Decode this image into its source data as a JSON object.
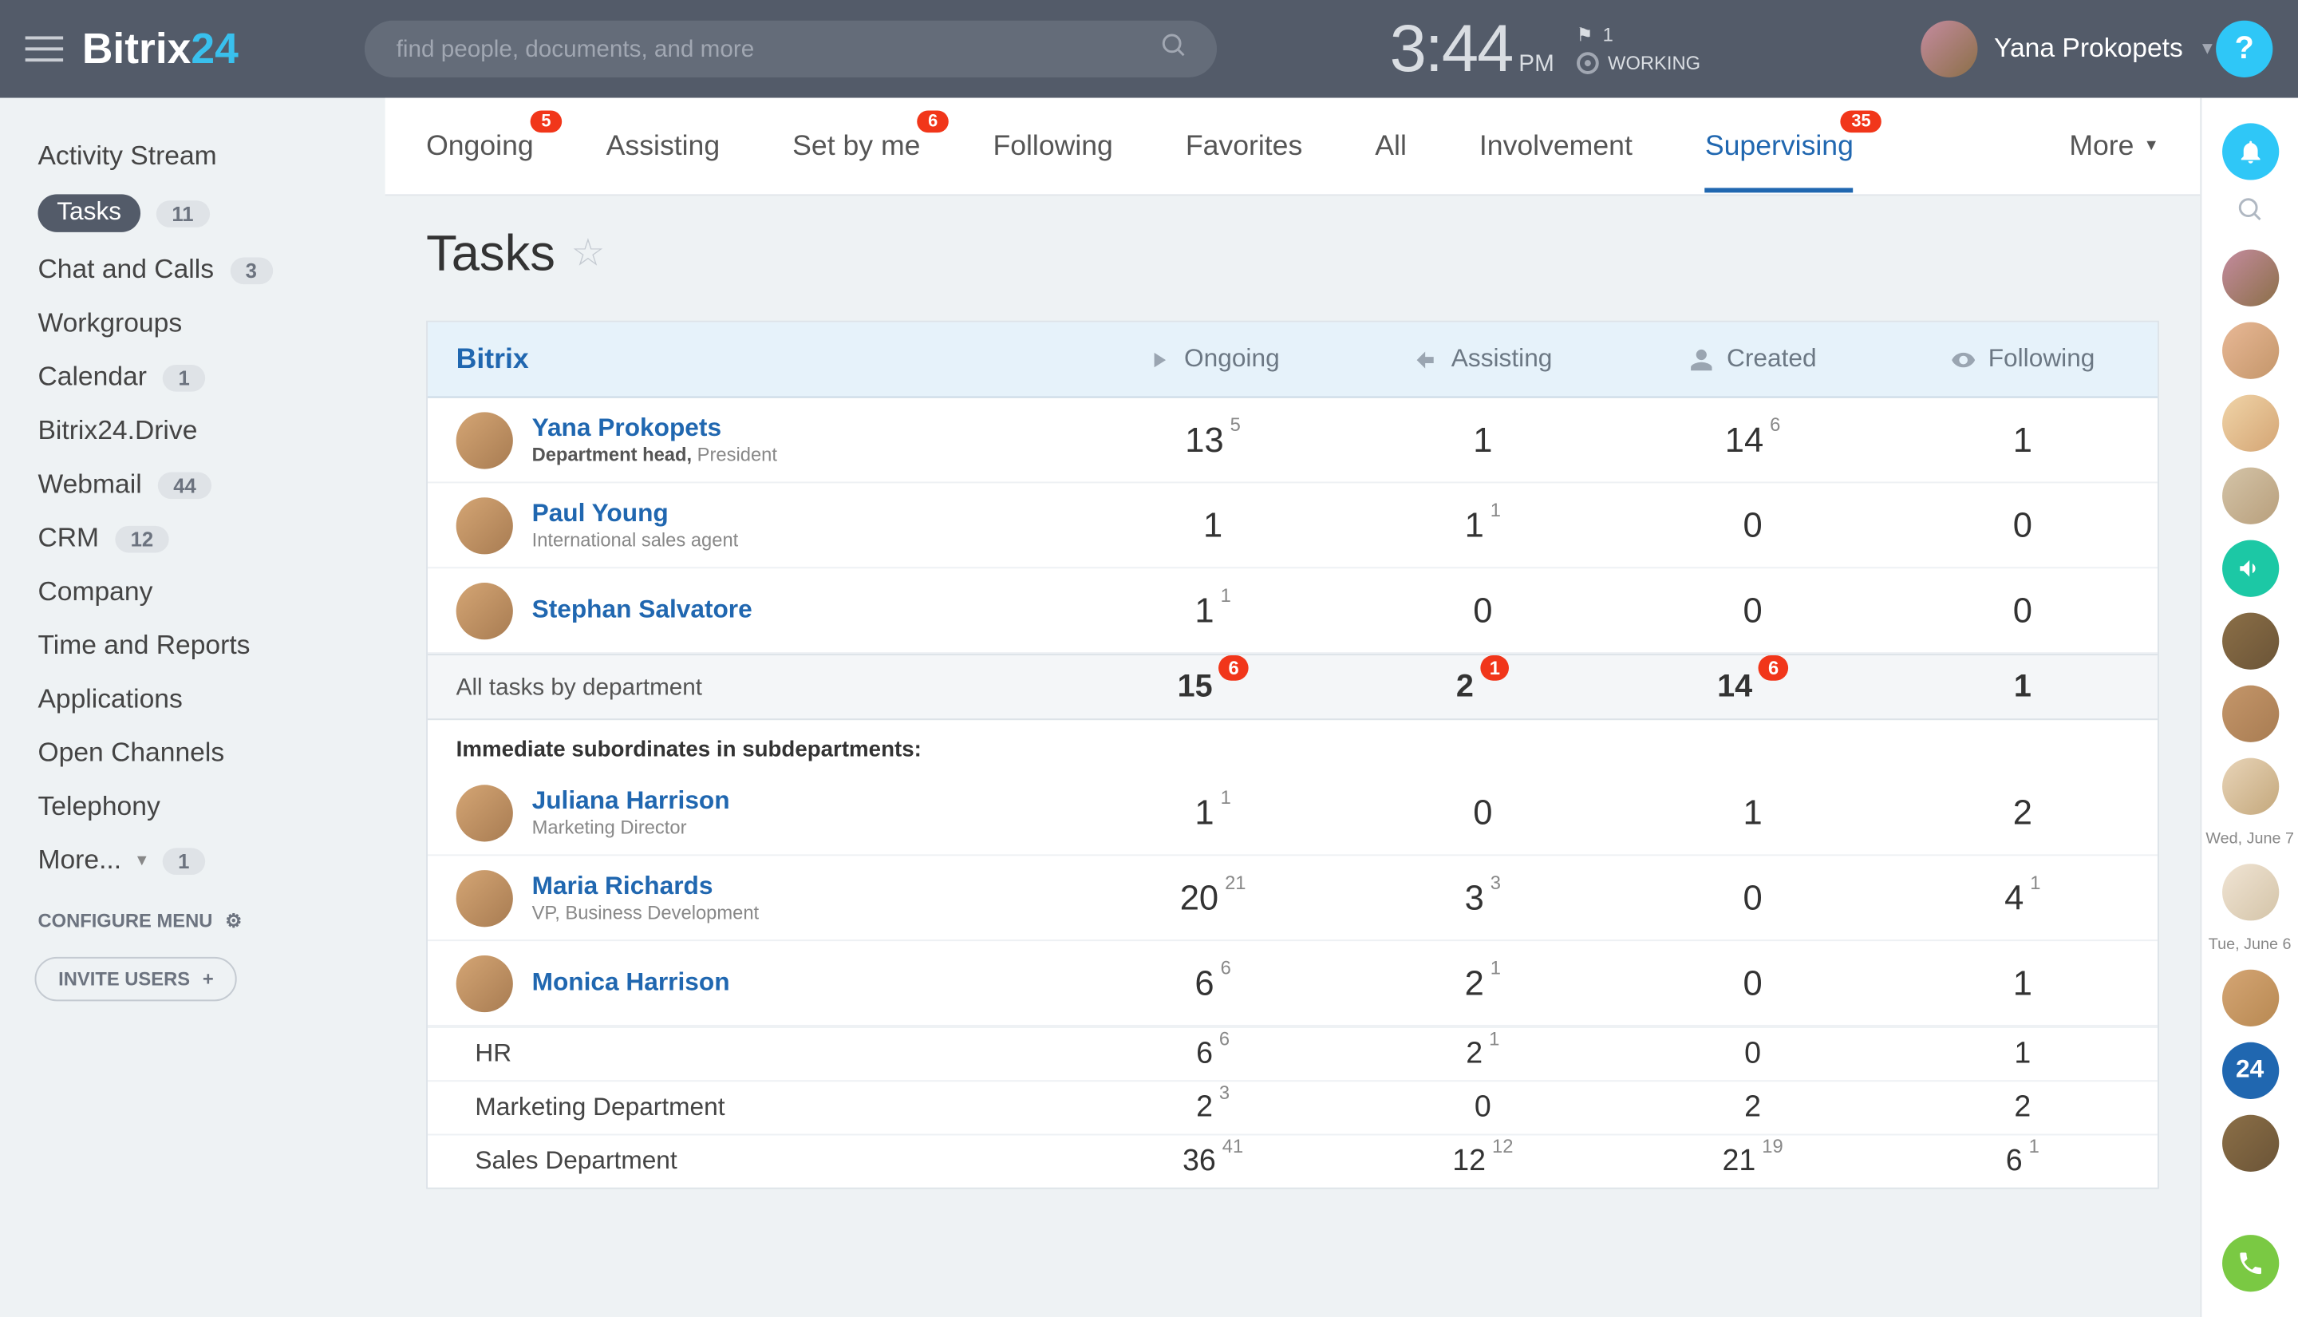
{
  "header": {
    "logo_main": "Bitrix",
    "logo_accent": "24",
    "search_placeholder": "find people, documents, and more",
    "clock_time": "3:44",
    "clock_ampm": "PM",
    "flag_count": "1",
    "working_label": "WORKING",
    "user_name": "Yana Prokopets",
    "help_label": "?"
  },
  "sidebar": {
    "items": [
      {
        "label": "Activity Stream",
        "count": ""
      },
      {
        "label": "Tasks",
        "count": "11",
        "active": true
      },
      {
        "label": "Chat and Calls",
        "count": "3"
      },
      {
        "label": "Workgroups",
        "count": ""
      },
      {
        "label": "Calendar",
        "count": "1"
      },
      {
        "label": "Bitrix24.Drive",
        "count": ""
      },
      {
        "label": "Webmail",
        "count": "44"
      },
      {
        "label": "CRM",
        "count": "12"
      },
      {
        "label": "Company",
        "count": ""
      },
      {
        "label": "Time and Reports",
        "count": ""
      },
      {
        "label": "Applications",
        "count": ""
      },
      {
        "label": "Open Channels",
        "count": ""
      },
      {
        "label": "Telephony",
        "count": ""
      }
    ],
    "more_label": "More...",
    "more_count": "1",
    "configure_label": "CONFIGURE MENU",
    "invite_label": "INVITE USERS"
  },
  "tabs": [
    {
      "label": "Ongoing",
      "badge": "5"
    },
    {
      "label": "Assisting",
      "badge": ""
    },
    {
      "label": "Set by me",
      "badge": "6"
    },
    {
      "label": "Following",
      "badge": ""
    },
    {
      "label": "Favorites",
      "badge": ""
    },
    {
      "label": "All",
      "badge": ""
    },
    {
      "label": "Involvement",
      "badge": ""
    },
    {
      "label": "Supervising",
      "badge": "35",
      "active": true
    }
  ],
  "tab_more": "More",
  "page_title": "Tasks",
  "table": {
    "org": "Bitrix",
    "cols": [
      "Ongoing",
      "Assisting",
      "Created",
      "Following"
    ],
    "rows": [
      {
        "name": "Yana Prokopets",
        "role_b": "Department head,",
        "role": " President",
        "cells": [
          "13",
          "1",
          "14",
          "1"
        ],
        "sups": [
          "5",
          "",
          "6",
          ""
        ]
      },
      {
        "name": "Paul Young",
        "role_b": "",
        "role": "International sales agent",
        "cells": [
          "1",
          "1",
          "0",
          "0"
        ],
        "sups": [
          "",
          "1",
          "",
          ""
        ]
      },
      {
        "name": "Stephan Salvatore",
        "role_b": "",
        "role": "",
        "cells": [
          "1",
          "0",
          "0",
          "0"
        ],
        "sups": [
          "1",
          "",
          "",
          ""
        ]
      }
    ],
    "subtotal_label": "All tasks by department",
    "subtotal_cells": [
      "15",
      "2",
      "14",
      "1"
    ],
    "subtotal_sups": [
      "6",
      "1",
      "6",
      ""
    ],
    "subhead": "Immediate subordinates in subdepartments:",
    "subs": [
      {
        "name": "Juliana Harrison",
        "role": "Marketing Director",
        "cells": [
          "1",
          "0",
          "1",
          "2"
        ],
        "sups": [
          "1",
          "",
          "",
          ""
        ]
      },
      {
        "name": "Maria Richards",
        "role": "VP, Business Development",
        "cells": [
          "20",
          "3",
          "0",
          "4"
        ],
        "sups": [
          "21",
          "3",
          "",
          "1"
        ]
      },
      {
        "name": "Monica Harrison",
        "role": "",
        "cells": [
          "6",
          "2",
          "0",
          "1"
        ],
        "sups": [
          "6",
          "1",
          "",
          ""
        ]
      }
    ],
    "depts": [
      {
        "name": "HR",
        "cells": [
          "6",
          "2",
          "0",
          "1"
        ],
        "sups": [
          "6",
          "1",
          "",
          ""
        ]
      },
      {
        "name": "Marketing Department",
        "cells": [
          "2",
          "0",
          "2",
          "2"
        ],
        "sups": [
          "3",
          "",
          "",
          ""
        ]
      },
      {
        "name": "Sales Department",
        "cells": [
          "36",
          "12",
          "21",
          "6"
        ],
        "sups": [
          "41",
          "12",
          "19",
          "1"
        ]
      }
    ]
  },
  "rail": {
    "dates": [
      "Wed, June 7",
      "Tue, June 6"
    ],
    "b24_label": "24"
  }
}
